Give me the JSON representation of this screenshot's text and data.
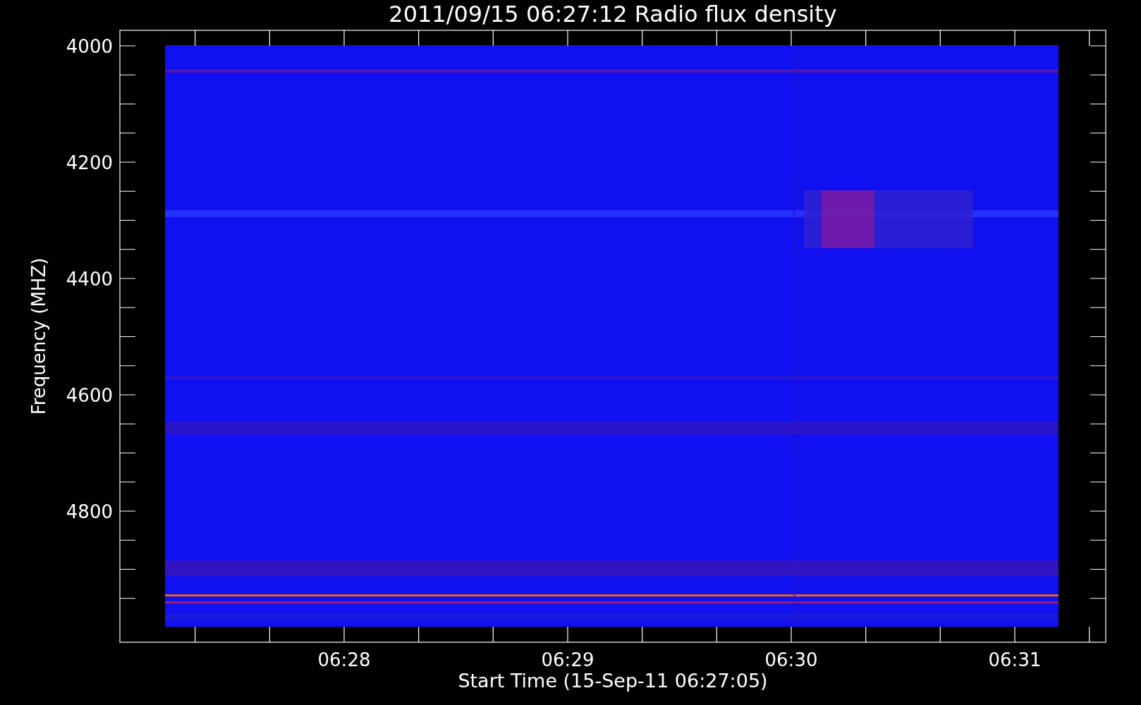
{
  "plot": {
    "title": "2011/09/15 06:27:12 Radio flux density",
    "y_axis": {
      "label": "Frequency (MHZ)",
      "ticks": [
        "4000",
        "4200",
        "4400",
        "4600",
        "4800"
      ]
    },
    "x_axis": {
      "label": "Start Time (15-Sep-11 06:27:05)",
      "ticks": [
        "06:28",
        "06:29",
        "06:30",
        "06:31"
      ]
    }
  }
}
